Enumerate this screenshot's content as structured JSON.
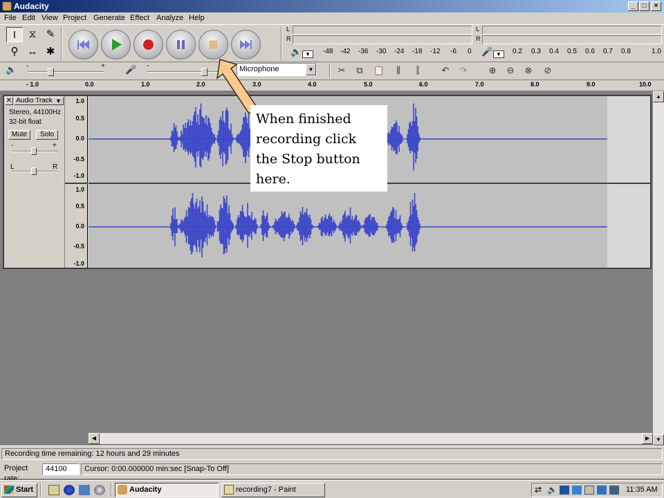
{
  "window": {
    "title": "Audacity",
    "controls": [
      "_",
      "□",
      "×"
    ]
  },
  "menu": [
    "File",
    "Edit",
    "View",
    "Project",
    "Generate",
    "Effect",
    "Analyze",
    "Help"
  ],
  "tools": [
    {
      "name": "selection-tool",
      "glyph": "I"
    },
    {
      "name": "envelope-tool",
      "glyph": "⧖"
    },
    {
      "name": "draw-tool",
      "glyph": "✎"
    },
    {
      "name": "zoom-tool",
      "glyph": "⚲"
    },
    {
      "name": "time-shift-tool",
      "glyph": "↔"
    },
    {
      "name": "multi-tool",
      "glyph": "✱"
    }
  ],
  "playback_meter": {
    "channel_labels": [
      "L",
      "R"
    ],
    "scale": [
      "-48",
      "-42",
      "-36",
      "-30",
      "-24",
      "-18",
      "-12",
      "-6",
      "0"
    ]
  },
  "record_meter": {
    "channel_labels": [
      "L",
      "R"
    ],
    "scale": [
      "0.2",
      "0.3",
      "0.4",
      "0.5",
      "0.6",
      "0.7",
      "0.8",
      "1.0"
    ]
  },
  "mixer": {
    "output_minus": "-",
    "output_plus": "+",
    "input_minus": "-",
    "input_plus": "+",
    "input_source": "Microphone",
    "output_volume": 0.3,
    "input_volume": 0.75
  },
  "ruler": [
    "- 1.0",
    "0.0",
    "1.0",
    "2.0",
    "3.0",
    "4.0",
    "5.0",
    "6.0",
    "7.0",
    "8.0",
    "9.0",
    "10.0"
  ],
  "track": {
    "name": "Audio Track",
    "format_line1": "Stereo, 44100Hz",
    "format_line2": "32-bit float",
    "mute_label": "Mute",
    "solo_label": "Solo",
    "gain_minus": "-",
    "gain_plus": "+",
    "pan_left": "L",
    "pan_right": "R",
    "vruler": [
      "1.0",
      "0.5",
      "0.0",
      "-0.5",
      "-1.0"
    ]
  },
  "annotation": "When finished recording click the Stop button here.",
  "status": {
    "message": "Recording time remaining: 12 hours and 29 minutes",
    "project_rate_label": "Project rate:",
    "project_rate_value": "44100",
    "cursor": "Cursor: 0:00.000000 min:sec   [Snap-To Off]"
  },
  "taskbar": {
    "start_label": "Start",
    "tasks": [
      {
        "label": "Audacity",
        "active": true
      },
      {
        "label": "recording7 - Paint",
        "active": false
      }
    ],
    "clock": "11:35 AM"
  },
  "colors": {
    "title_gradient_start": "#0a246a",
    "waveform": "#3c46c8",
    "arrow": "#f9c98f",
    "record_dot": "#d02020",
    "play_triangle": "#28a028"
  }
}
